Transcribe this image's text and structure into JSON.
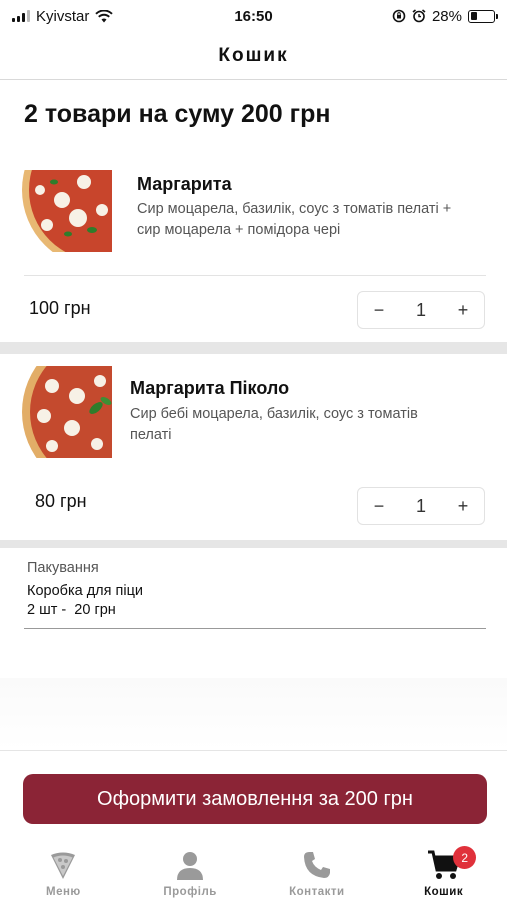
{
  "status_bar": {
    "carrier": "Kyivstar",
    "time": "16:50",
    "battery": "28%",
    "battery_level": 0.28
  },
  "header": {
    "title": "Кошик"
  },
  "summary": "2 товари на суму 200 грн",
  "cart": {
    "items": [
      {
        "name": "Маргарита",
        "description": "Сир моцарела, базилік, соус з томатів пелаті + сир моцарела + помідора чері",
        "price": "100 грн",
        "quantity": "1",
        "minus": "−",
        "plus": "+"
      },
      {
        "name": "Маргарита Піколо",
        "description": "Сир бебі моцарела, базилік, соус з томатів пелаті",
        "price": "80 грн",
        "quantity": "1",
        "minus": "−",
        "plus": "+"
      }
    ]
  },
  "packaging": {
    "title": "Пакування",
    "name": "Коробка для піци",
    "quantity_price": "2 шт -  20 грн"
  },
  "checkout": {
    "label": "Оформити замовлення за 200 грн"
  },
  "tabbar": {
    "tabs": [
      {
        "label": "Меню",
        "icon": "pizza-icon"
      },
      {
        "label": "Профіль",
        "icon": "user-icon"
      },
      {
        "label": "Контакти",
        "icon": "phone-icon"
      },
      {
        "label": "Кошик",
        "icon": "cart-icon",
        "badge": "2",
        "active": true
      }
    ]
  },
  "colors": {
    "accent": "#8b2436",
    "badge": "#e0313b",
    "inactive_tab": "#9a9a9a"
  }
}
